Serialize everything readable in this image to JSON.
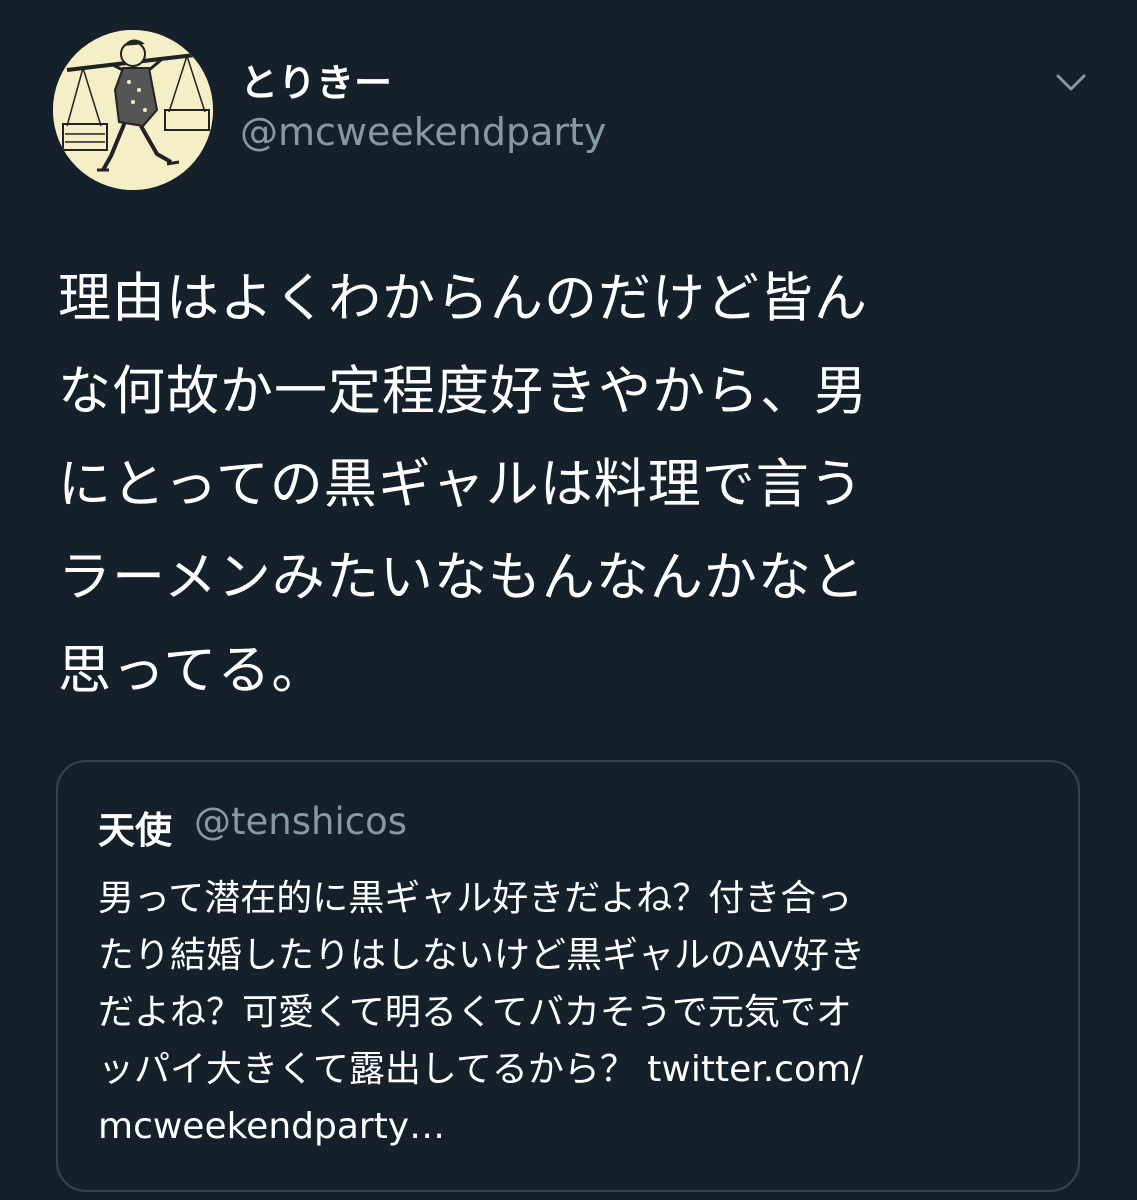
{
  "tweet": {
    "author": {
      "display_name": "とりきー",
      "handle": "@mcweekendparty",
      "avatar_icon": "avatar-illustration-icon"
    },
    "menu_icon": "chevron-down-icon",
    "text": "理由はよくわからんのだけど皆ん\nな何故か一定程度好きやから、男\nにとっての黒ギャルは料理で言う\nラーメンみたいなもんなんかなと\n思ってる。"
  },
  "quoted_tweet": {
    "display_name": "天使",
    "handle": "@tenshicos",
    "text": "男って潜在的に黒ギャル好きだよね？付き合っ\nたり結婚したりはしないけど黒ギャルのAV好き\nだよね？可愛くて明るくてバカそうで元気でオ\nッパイ大きくて露出してるから？ twitter.com/\nmcweekendparty…"
  },
  "colors": {
    "background": "#15202b",
    "primary_text": "#ffffff",
    "secondary_text": "#8899a6",
    "border": "#38444d",
    "avatar_bg": "#f4efc6"
  }
}
